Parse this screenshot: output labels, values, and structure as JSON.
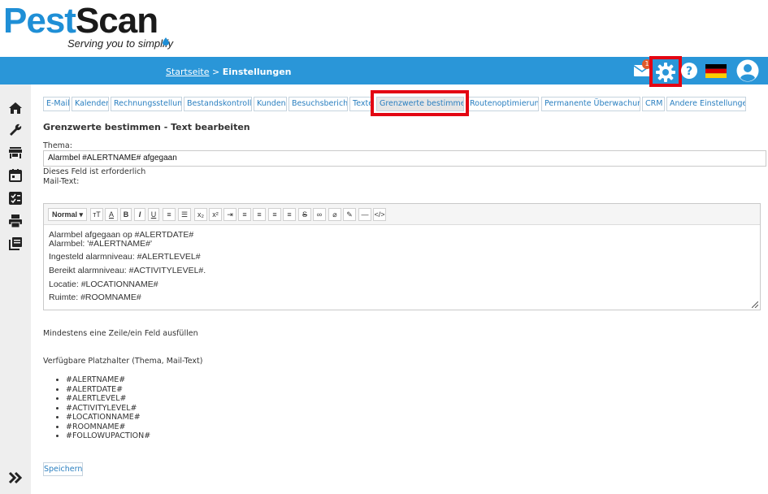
{
  "logo": {
    "part1": "Pest",
    "part2": "Scan",
    "tagline": "Serving you to simplify"
  },
  "breadcrumb": {
    "home": "Startseite",
    "separator": " > ",
    "current": "Einstellungen"
  },
  "header": {
    "mail_badge": "1",
    "brand_color": "#2a96d8",
    "highlight_color": "#e30613"
  },
  "tabs": [
    "E-Mail",
    "Kalender",
    "Rechnungsstellung",
    "Bestandskontrolle",
    "Kunden",
    "Besuchsbericht",
    "Texte",
    "Grenzwerte bestimmen",
    "Routenoptimierung",
    "Permanente Überwachung",
    "CRM",
    "Andere Einstellungen"
  ],
  "active_tab": "Grenzwerte bestimmen",
  "form": {
    "title": "Grenzwerte bestimmen - Text bearbeiten",
    "subject_label": "Thema:",
    "subject_value": "Alarmbel #ALERTNAME# afgegaan",
    "required_note": "Dieses Feld ist erforderlich",
    "mailtext_label": "Mail-Text:"
  },
  "editor": {
    "style_select": "Normal",
    "toolbar_icons": [
      "font-size-icon",
      "font-color-icon",
      "bold-icon",
      "italic-icon",
      "underline-icon",
      "ordered-list-icon",
      "unordered-list-icon",
      "subscript-icon",
      "superscript-icon",
      "indent-icon",
      "align-left-icon",
      "align-justify-icon",
      "align-center-icon",
      "align-right-icon",
      "strikethrough-icon",
      "link-icon",
      "unlink-icon",
      "clear-format-icon",
      "horizontal-rule-icon",
      "code-view-icon"
    ],
    "lines": [
      "Alarmbel afgegaan op #ALERTDATE#",
      "Alarmbel: '#ALERTNAME#'",
      "Ingesteld alarmniveau: #ALERTLEVEL#",
      "Bereikt alarmniveau: #ACTIVITYLEVEL#.",
      "Locatie: #LOCATIONNAME#",
      "Ruimte: #ROOMNAME#"
    ]
  },
  "notes": {
    "min_line": "Mindestens eine Zeile/ein Feld ausfüllen",
    "placeholders_title": "Verfügbare Platzhalter (Thema, Mail-Text)"
  },
  "placeholders": [
    "#ALERTNAME#",
    "#ALERTDATE#",
    "#ALERTLEVEL#",
    "#ACTIVITYLEVEL#",
    "#LOCATIONNAME#",
    "#ROOMNAME#",
    "#FOLLOWUPACTION#"
  ],
  "save_label": "Speichern",
  "sidebar_icons": [
    "home-icon",
    "wrench-icon",
    "store-icon",
    "calendar-icon",
    "checklist-icon",
    "printer-icon",
    "library-icon",
    "expand-icon"
  ]
}
